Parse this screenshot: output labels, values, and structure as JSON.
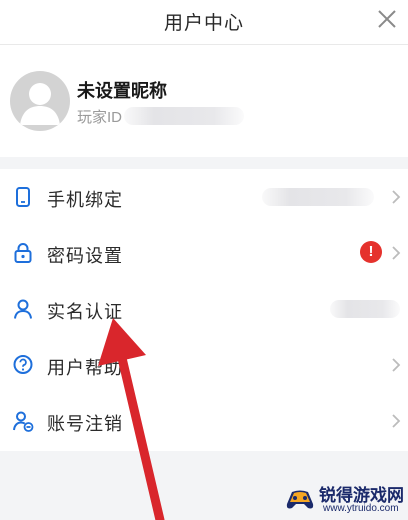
{
  "header": {
    "title": "用户中心",
    "close_icon": "close-icon"
  },
  "profile": {
    "nickname": "未设置昵称",
    "player_id_label": "玩家ID",
    "avatar_icon": "default-avatar-icon"
  },
  "menu": {
    "items": [
      {
        "label": "手机绑定",
        "icon": "phone-icon"
      },
      {
        "label": "密码设置",
        "icon": "lock-icon",
        "badge": "!"
      },
      {
        "label": "实名认证",
        "icon": "person-icon"
      },
      {
        "label": "用户帮助",
        "icon": "help-icon"
      },
      {
        "label": "账号注销",
        "icon": "account-cancel-icon"
      }
    ]
  },
  "colors": {
    "accent": "#1e6fdb",
    "alert": "#e5322d",
    "arrow": "#d9262c"
  },
  "watermark": {
    "title": "锐得游戏网",
    "url": "www.ytruido.com"
  }
}
